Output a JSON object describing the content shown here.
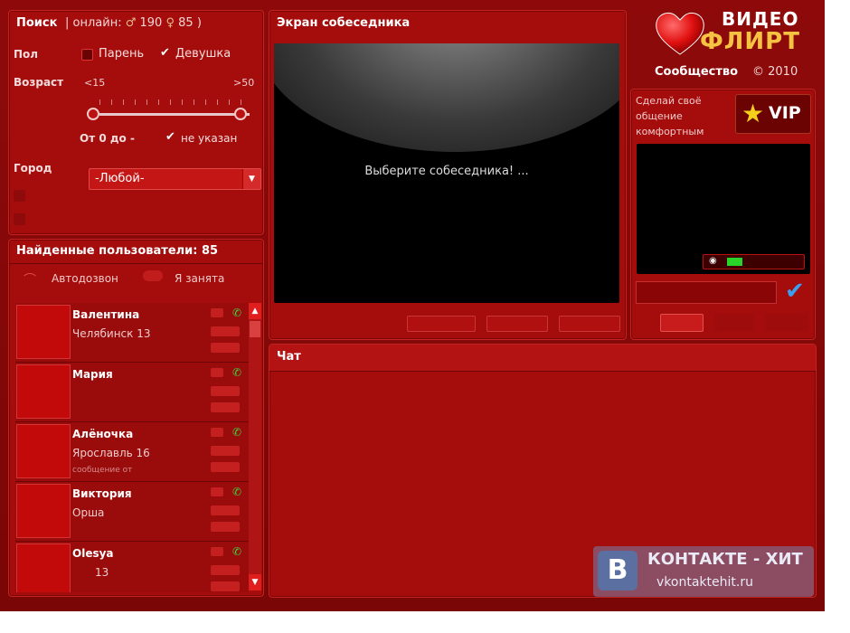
{
  "search": {
    "title": "Поиск",
    "online_label": "онлайн:",
    "online_male": "190",
    "online_female": "85",
    "gender_label": "Пол",
    "gender_male": "Парень",
    "gender_female": "Девушка",
    "gender_male_checked": false,
    "gender_female_checked": true,
    "age_label": "Возраст",
    "age_min": "<15",
    "age_max": ">50",
    "age_range_text": "От 0 до -",
    "age_unspecified": "не указан",
    "age_unspecified_checked": true,
    "city_label": "Город",
    "city_value": "-Любой-"
  },
  "users": {
    "title": "Найденные пользователи: 85",
    "autodial": "Автодозвон",
    "busy": "Я занята",
    "list": [
      {
        "name": "Валентина",
        "city": "Челябинск 13",
        "note": ""
      },
      {
        "name": "Мария",
        "city": "",
        "note": ""
      },
      {
        "name": "Алёночка",
        "city": "Ярославль 16",
        "note": "сообщение от"
      },
      {
        "name": "Виктория",
        "city": "Орша",
        "note": ""
      },
      {
        "name": "Olesya",
        "city": "13",
        "note": ""
      }
    ]
  },
  "video": {
    "title": "Экран собеседника",
    "message": "Выберите собеседника! ...",
    "buttons": [
      "",
      "",
      ""
    ]
  },
  "logo": {
    "line1": "ВИДЕО",
    "line2": "ФЛИРТ",
    "community": "Сообщество",
    "year": "© 2010"
  },
  "vip": {
    "text": "Сделай своё общение комфортным",
    "button": "VIP",
    "mic_level": 0.15
  },
  "chat": {
    "title": "Чат"
  },
  "watermark": {
    "logo": "В",
    "line1": "КОНТАКТЕ - ХИТ",
    "line2": "vkontaktehit.ru"
  },
  "colors": {
    "background": "#8e0a0a",
    "panel": "#a50d0d",
    "accent_gold": "#f5c242",
    "green": "#2ad32a"
  }
}
